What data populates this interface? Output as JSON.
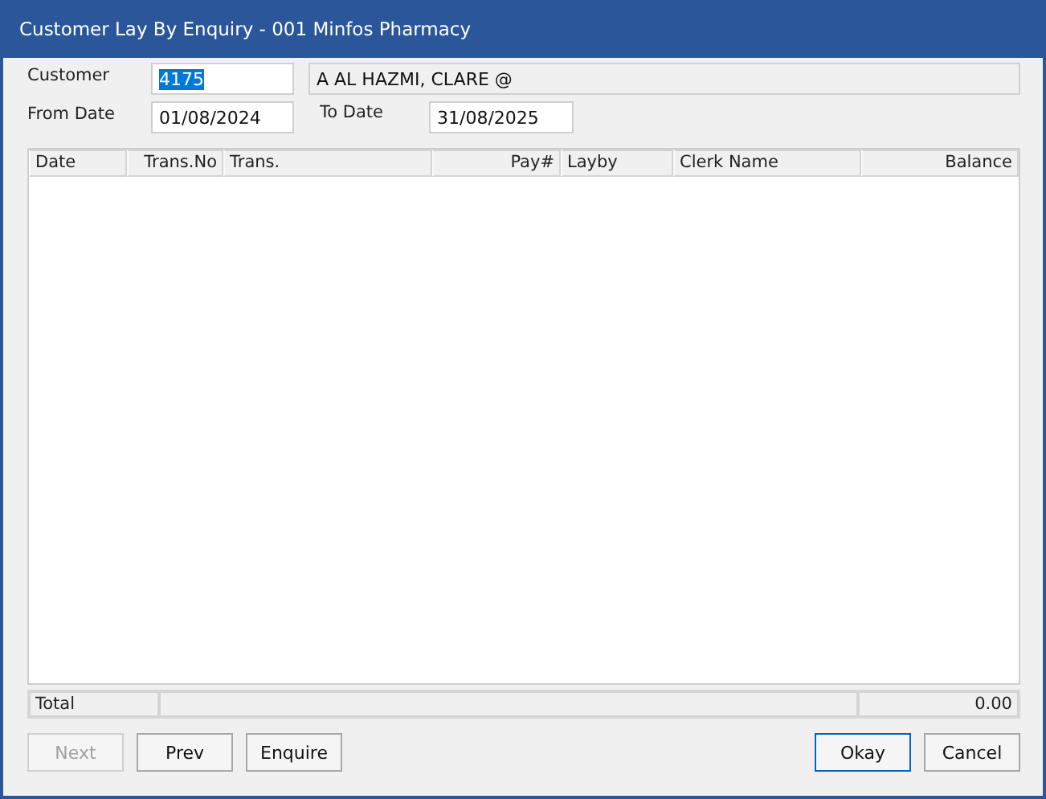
{
  "window": {
    "title": "Customer Lay By Enquiry - 001 Minfos Pharmacy"
  },
  "customer": {
    "label": "Customer",
    "value": "4175",
    "text_selected": true,
    "name": "A AL HAZMI, CLARE @"
  },
  "from_date": {
    "label": "From Date",
    "value": "01/08/2024"
  },
  "to_date": {
    "label": "To Date",
    "value": "31/08/2025"
  },
  "table": {
    "columns": [
      {
        "label": "Date"
      },
      {
        "label": "Trans.No"
      },
      {
        "label": "Trans."
      },
      {
        "label": "Pay#"
      },
      {
        "label": "Layby"
      },
      {
        "label": "Clerk Name"
      },
      {
        "label": "Balance"
      }
    ]
  },
  "totals": {
    "label": "Total",
    "value": "0.00"
  },
  "buttons": [
    {
      "label": "Next",
      "disabled": true,
      "default": false
    },
    {
      "label": "Prev",
      "disabled": false,
      "default": false
    },
    {
      "label": "Enquire",
      "disabled": false,
      "default": false
    },
    {
      "label": "Okay",
      "disabled": false,
      "default": true
    },
    {
      "label": "Cancel",
      "disabled": false,
      "default": false
    }
  ]
}
